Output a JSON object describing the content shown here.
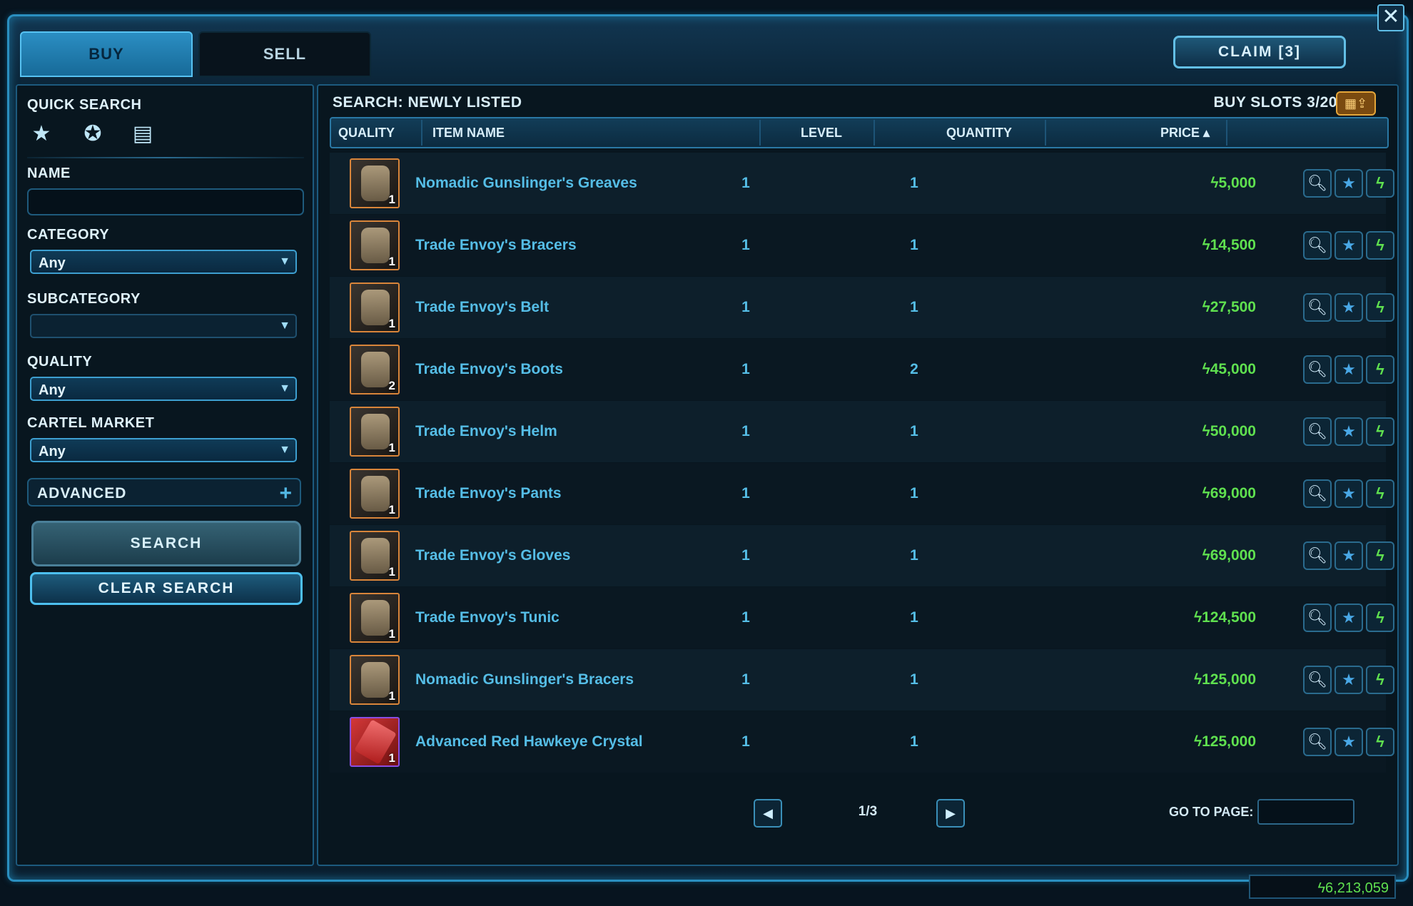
{
  "window": {
    "close_glyph": "✕"
  },
  "tabs": [
    {
      "label": "BUY",
      "active": true
    },
    {
      "label": "SELL",
      "active": false
    }
  ],
  "claim_label": "CLAIM [3]",
  "left": {
    "quick_search_label": "QUICK SEARCH",
    "quick_icons": [
      "star-icon",
      "award-icon",
      "document-icon"
    ],
    "name_label": "NAME",
    "name_value": "",
    "category_label": "CATEGORY",
    "category_value": "Any",
    "subcategory_label": "SUBCATEGORY",
    "subcategory_value": "",
    "quality_label": "QUALITY",
    "quality_value": "Any",
    "cartel_label": "CARTEL MARKET",
    "cartel_value": "Any",
    "advanced_label": "ADVANCED",
    "search_label": "SEARCH",
    "clear_label": "CLEAR SEARCH"
  },
  "results": {
    "title": "SEARCH: NEWLY LISTED",
    "buy_slots": "BUY SLOTS 3/20",
    "columns": {
      "quality": "QUALITY",
      "name": "ITEM NAME",
      "level": "LEVEL",
      "quantity": "QUANTITY",
      "price": "PRICE ▴"
    },
    "items": [
      {
        "name": "Nomadic Gunslinger's Greaves",
        "level": "1",
        "quantity": "1",
        "price": "ϟ5,000",
        "stack": "1",
        "quality_color": "orange"
      },
      {
        "name": "Trade Envoy's Bracers",
        "level": "1",
        "quantity": "1",
        "price": "ϟ14,500",
        "stack": "1",
        "quality_color": "orange"
      },
      {
        "name": "Trade Envoy's Belt",
        "level": "1",
        "quantity": "1",
        "price": "ϟ27,500",
        "stack": "1",
        "quality_color": "orange"
      },
      {
        "name": "Trade Envoy's Boots",
        "level": "1",
        "quantity": "2",
        "price": "ϟ45,000",
        "stack": "2",
        "quality_color": "orange"
      },
      {
        "name": "Trade Envoy's Helm",
        "level": "1",
        "quantity": "1",
        "price": "ϟ50,000",
        "stack": "1",
        "quality_color": "orange"
      },
      {
        "name": "Trade Envoy's Pants",
        "level": "1",
        "quantity": "1",
        "price": "ϟ69,000",
        "stack": "1",
        "quality_color": "orange"
      },
      {
        "name": "Trade Envoy's Gloves",
        "level": "1",
        "quantity": "1",
        "price": "ϟ69,000",
        "stack": "1",
        "quality_color": "orange"
      },
      {
        "name": "Trade Envoy's Tunic",
        "level": "1",
        "quantity": "1",
        "price": "ϟ124,500",
        "stack": "1",
        "quality_color": "orange"
      },
      {
        "name": "Nomadic Gunslinger's Bracers",
        "level": "1",
        "quantity": "1",
        "price": "ϟ125,000",
        "stack": "1",
        "quality_color": "orange"
      },
      {
        "name": "Advanced Red Hawkeye Crystal",
        "level": "1",
        "quantity": "1",
        "price": "ϟ125,000",
        "stack": "1",
        "quality_color": "purple"
      }
    ],
    "pager": {
      "text": "1/3",
      "goto_label": "GO TO PAGE:",
      "goto_value": ""
    }
  },
  "credits": "ϟ6,213,059",
  "colors": {
    "accent": "#2a8fc0",
    "item_name": "#55bde6",
    "price": "#5fe04f"
  }
}
